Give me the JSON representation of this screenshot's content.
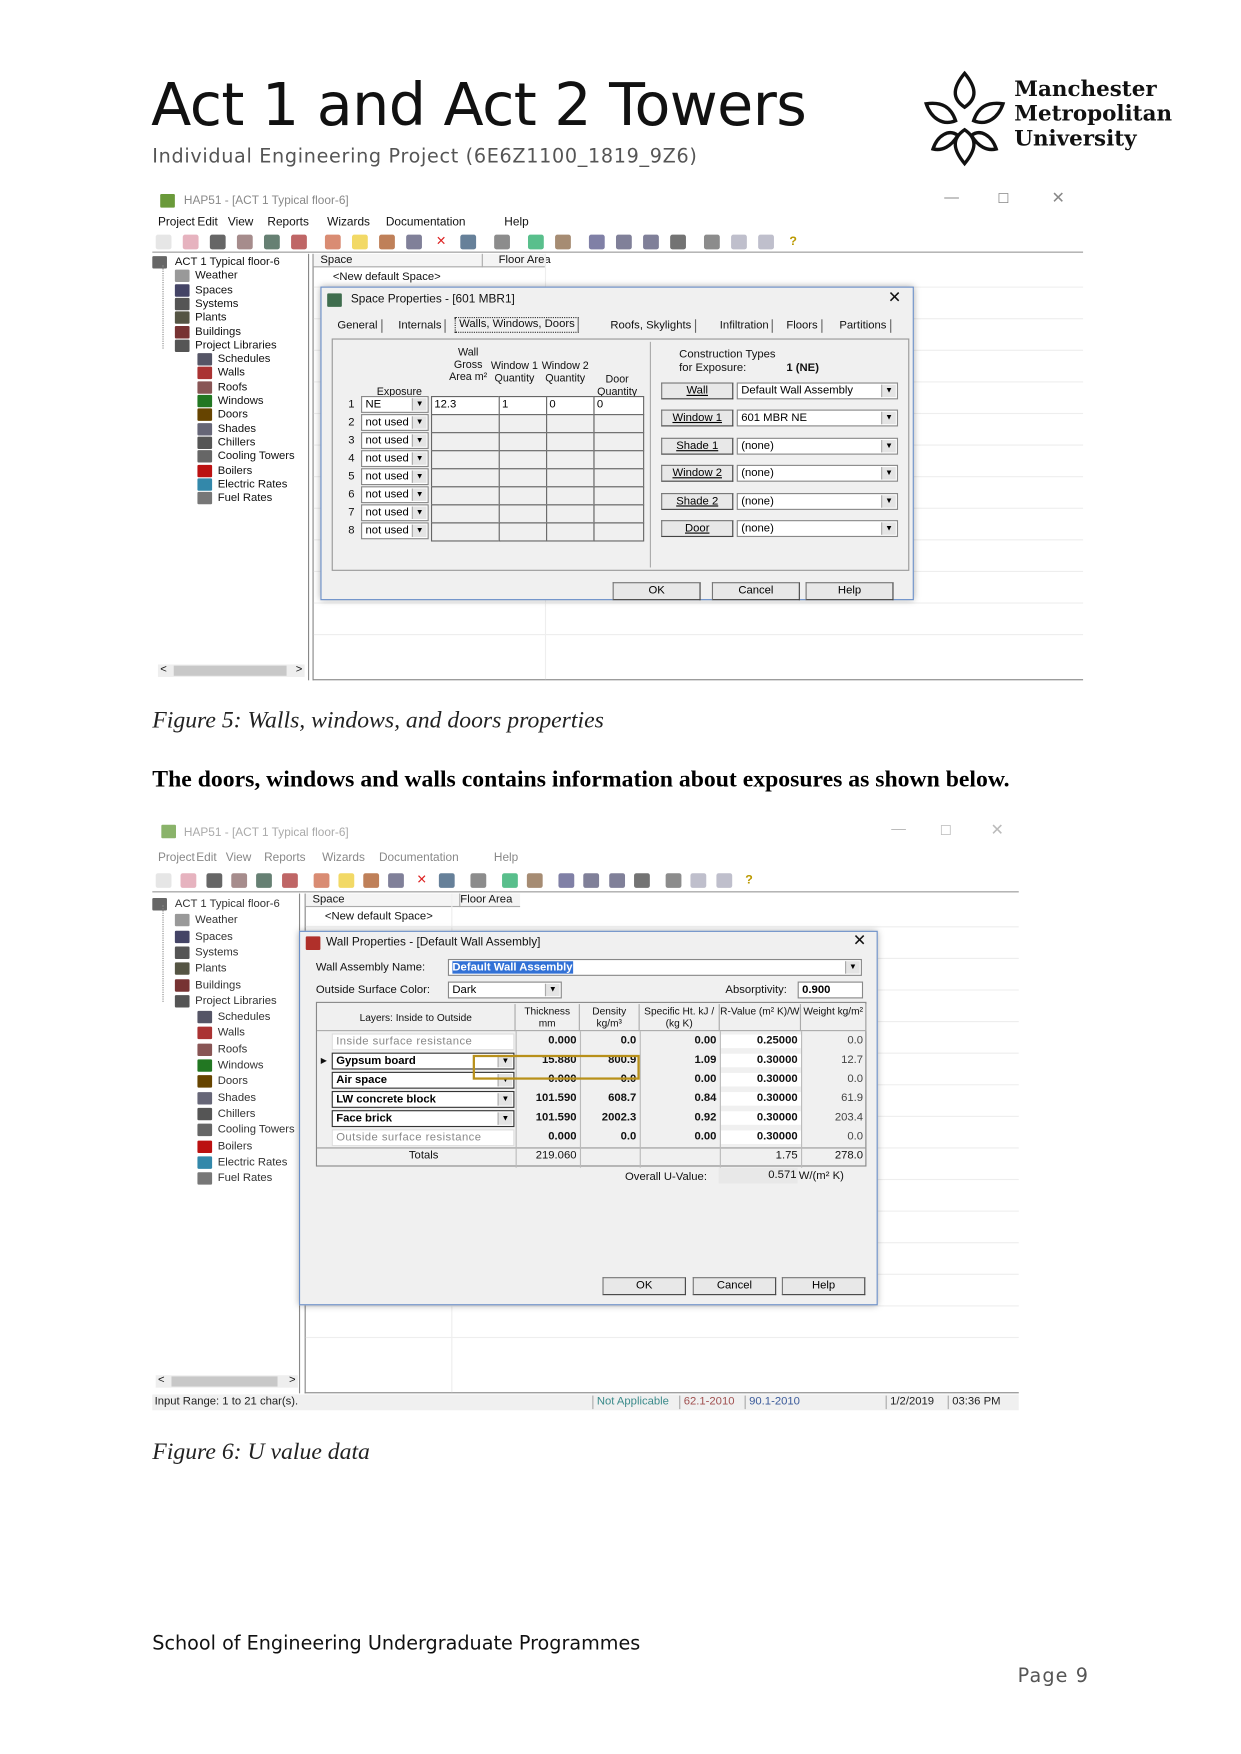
{
  "header": {
    "title": "Act 1 and Act 2 Towers",
    "subtitle": "Individual Engineering Project (6E6Z1100_1819_9Z6)",
    "logo": [
      "Manchester",
      "Metropolitan",
      "University"
    ]
  },
  "fig1": {
    "window_title": "HAP51 - [ACT 1 Typical floor-6]",
    "menu": [
      "Project",
      "Edit",
      "View",
      "Reports",
      "Wizards",
      "Documentation",
      "Help"
    ],
    "tree": [
      "ACT 1 Typical floor-6",
      "Weather",
      "Spaces",
      "Systems",
      "Plants",
      "Buildings",
      "Project Libraries",
      "Schedules",
      "Walls",
      "Roofs",
      "Windows",
      "Doors",
      "Shades",
      "Chillers",
      "Cooling Towers",
      "Boilers",
      "Electric Rates",
      "Fuel Rates"
    ],
    "list_headers": [
      "Space",
      "Floor Area"
    ],
    "list_rows": [
      "<New default Space>"
    ],
    "dialog_title": "Space Properties - [601 MBR1]",
    "tabs": [
      "General",
      "Internals",
      "Walls, Windows, Doors",
      "Roofs, Skylights",
      "Infiltration",
      "Floors",
      "Partitions"
    ],
    "active_tab": "Walls, Windows, Doors",
    "grid_headers": {
      "exposure": "Exposure",
      "wall": "Wall Gross Area m²",
      "win1": "Window 1 Quantity",
      "win2": "Window 2 Quantity",
      "door": "Door Quantity"
    },
    "rows": [
      {
        "n": "1",
        "exposure": "NE",
        "wall": "12.3",
        "win1": "1",
        "win2": "0",
        "door": "0"
      },
      {
        "n": "2",
        "exposure": "not used"
      },
      {
        "n": "3",
        "exposure": "not used"
      },
      {
        "n": "4",
        "exposure": "not used"
      },
      {
        "n": "5",
        "exposure": "not used"
      },
      {
        "n": "6",
        "exposure": "not used"
      },
      {
        "n": "7",
        "exposure": "not used"
      },
      {
        "n": "8",
        "exposure": "not used"
      }
    ],
    "construction_label": "Construction Types",
    "exposure_label": "for Exposure:",
    "exposure_value": "1 (NE)",
    "constructions": [
      {
        "label": "Wall",
        "value": "Default Wall Assembly"
      },
      {
        "label": "Window 1",
        "value": "601 MBR NE"
      },
      {
        "label": "Shade 1",
        "value": "(none)"
      },
      {
        "label": "Window 2",
        "value": "(none)"
      },
      {
        "label": "Shade 2",
        "value": "(none)"
      },
      {
        "label": "Door",
        "value": "(none)"
      }
    ],
    "buttons": [
      "OK",
      "Cancel",
      "Help"
    ]
  },
  "caption1": "Figure 5: Walls, windows, and doors properties",
  "paragraph": "The doors, windows and walls contains information about exposures as shown below.",
  "fig2": {
    "window_title": "HAP51 - [ACT 1 Typical floor-6]",
    "menu": [
      "Project",
      "Edit",
      "View",
      "Reports",
      "Wizards",
      "Documentation",
      "Help"
    ],
    "tree": [
      "ACT 1 Typical floor-6",
      "Weather",
      "Spaces",
      "Systems",
      "Plants",
      "Buildings",
      "Project Libraries",
      "Schedules",
      "Walls",
      "Roofs",
      "Windows",
      "Doors",
      "Shades",
      "Chillers",
      "Cooling Towers",
      "Boilers",
      "Electric Rates",
      "Fuel Rates"
    ],
    "list_headers": [
      "Space",
      "Floor Area"
    ],
    "list_rows": [
      "<New default Space>"
    ],
    "dialog_title": "Wall Properties - [Default Wall Assembly]",
    "name_label": "Wall Assembly Name:",
    "name_value": "Default Wall Assembly",
    "color_label": "Outside Surface Color:",
    "color_value": "Dark",
    "absorptivity_label": "Absorptivity:",
    "absorptivity_value": "0.900",
    "columns": [
      "Layers: Inside to Outside",
      "Thickness mm",
      "Density kg/m³",
      "Specific Ht. kJ / (kg K)",
      "R-Value (m² K)/W",
      "Weight kg/m²"
    ],
    "layers": [
      {
        "name": "Inside surface resistance",
        "fixed": true,
        "thickness": "0.000",
        "density": "0.0",
        "specific": "0.00",
        "r": "0.25000",
        "weight": "0.0"
      },
      {
        "name": "Gypsum board",
        "thickness": "15.880",
        "density": "800.9",
        "specific": "1.09",
        "r": "0.30000",
        "weight": "12.7",
        "selected": true
      },
      {
        "name": "Air space",
        "thickness": "0.000",
        "density": "0.0",
        "specific": "0.00",
        "r": "0.30000",
        "weight": "0.0"
      },
      {
        "name": "LW concrete block",
        "thickness": "101.590",
        "density": "608.7",
        "specific": "0.84",
        "r": "0.30000",
        "weight": "61.9"
      },
      {
        "name": "Face brick",
        "thickness": "101.590",
        "density": "2002.3",
        "specific": "0.92",
        "r": "0.30000",
        "weight": "203.4"
      },
      {
        "name": "Outside surface resistance",
        "fixed": true,
        "thickness": "0.000",
        "density": "0.0",
        "specific": "0.00",
        "r": "0.30000",
        "weight": "0.0"
      }
    ],
    "totals": {
      "label": "Totals",
      "thickness": "219.060",
      "r": "1.75",
      "weight": "278.0"
    },
    "u_label": "Overall U-Value:",
    "u_value": "0.571",
    "u_unit": "W/(m² K)",
    "highlight_color": "#b8901a",
    "buttons": [
      "OK",
      "Cancel",
      "Help"
    ],
    "status": {
      "hint": "Input Range: 1 to 21 char(s).",
      "a": "Not Applicable",
      "b": "62.1-2010",
      "c": "90.1-2010",
      "date": "1/2/2019",
      "time": "03:36 PM"
    }
  },
  "caption2": "Figure 6: U value data",
  "footer": "School of Engineering Undergraduate Programmes",
  "page": "Page 9"
}
